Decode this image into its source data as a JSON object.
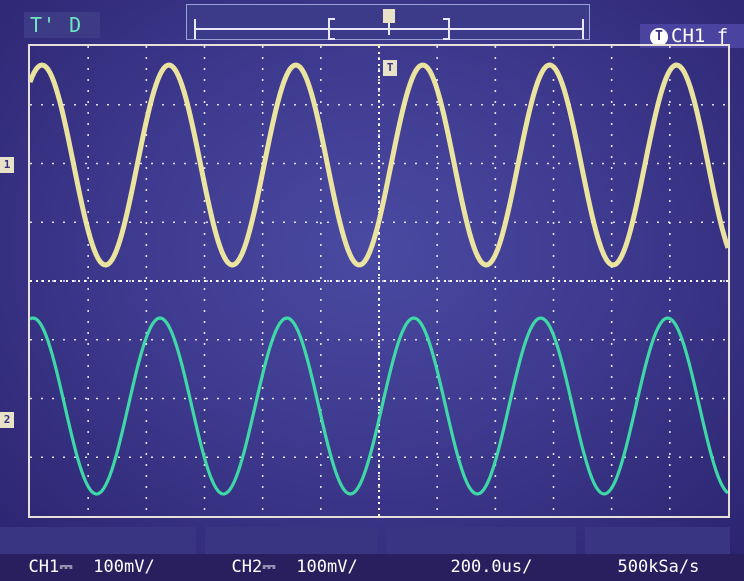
{
  "header": {
    "trigger_mode": "T' D",
    "trigger_source_badge": "T",
    "trigger_source": "CH1 ƒ"
  },
  "markers": {
    "trigger_position": "T",
    "ch1_marker": "1",
    "ch2_marker": "2"
  },
  "status": {
    "ch1_label": "CH1",
    "ch1_scale": "100mV/",
    "ch2_label": "CH2",
    "ch2_scale": "100mV/",
    "timebase": "200.0us/",
    "sample_rate": "500kSa/s"
  },
  "colors": {
    "ch1_trace": "#f3eda0",
    "ch2_trace": "#3fe0a8",
    "grid": "#ffffff",
    "background": "#3e3a8f"
  },
  "chart_data": [
    {
      "type": "line",
      "series": [
        {
          "name": "CH1",
          "cycles_on_screen": 5.5,
          "wave": "sine"
        },
        {
          "name": "CH2",
          "cycles_on_screen": 5.5,
          "wave": "sine"
        }
      ]
    }
  ]
}
